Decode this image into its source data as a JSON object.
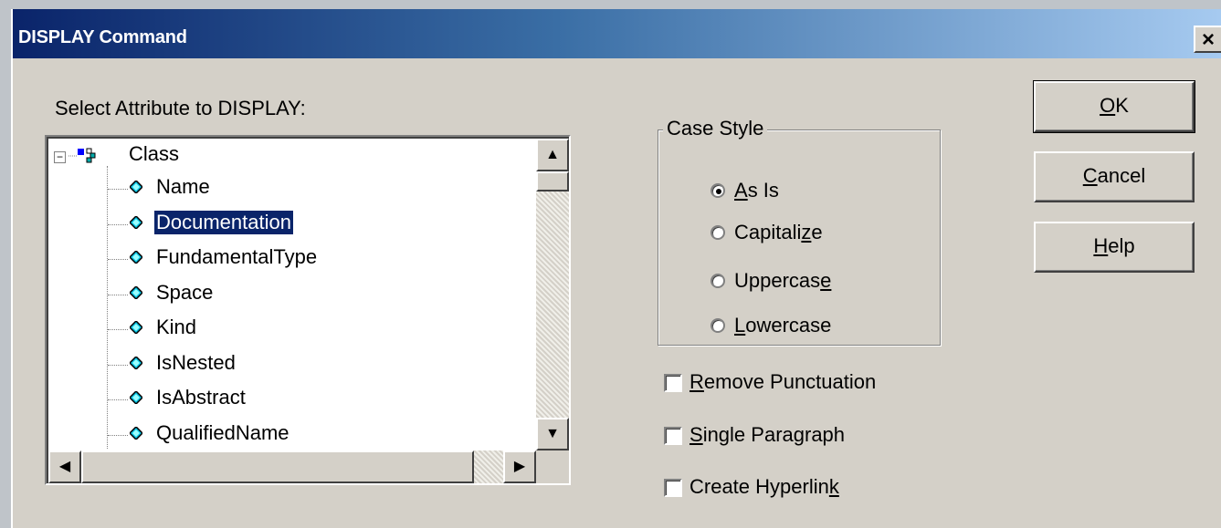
{
  "window": {
    "title": "DISPLAY Command",
    "close": "×"
  },
  "list": {
    "label": "Select Attribute to DISPLAY:",
    "root": "Class",
    "items": [
      "Name",
      "Documentation",
      "FundamentalType",
      "Space",
      "Kind",
      "IsNested",
      "IsAbstract",
      "QualifiedName"
    ],
    "selected": "Documentation"
  },
  "case_style": {
    "title": "Case Style",
    "options": [
      {
        "pre": "",
        "key": "A",
        "post": "s Is",
        "checked": true
      },
      {
        "pre": "Capitali",
        "key": "z",
        "post": "e",
        "checked": false
      },
      {
        "pre": "Uppercas",
        "key": "e",
        "post": "",
        "checked": false
      },
      {
        "pre": "",
        "key": "L",
        "post": "owercase",
        "checked": false
      }
    ]
  },
  "checks": [
    {
      "pre": "",
      "key": "R",
      "post": "emove Punctuation",
      "checked": false
    },
    {
      "pre": "",
      "key": "S",
      "post": "ingle Paragraph",
      "checked": false
    },
    {
      "pre": "Create Hyperlin",
      "key": "k",
      "post": "",
      "checked": false
    }
  ],
  "buttons": [
    {
      "pre": "",
      "key": "O",
      "post": "K"
    },
    {
      "pre": "",
      "key": "C",
      "post": "ancel"
    },
    {
      "pre": "",
      "key": "H",
      "post": "elp"
    }
  ]
}
